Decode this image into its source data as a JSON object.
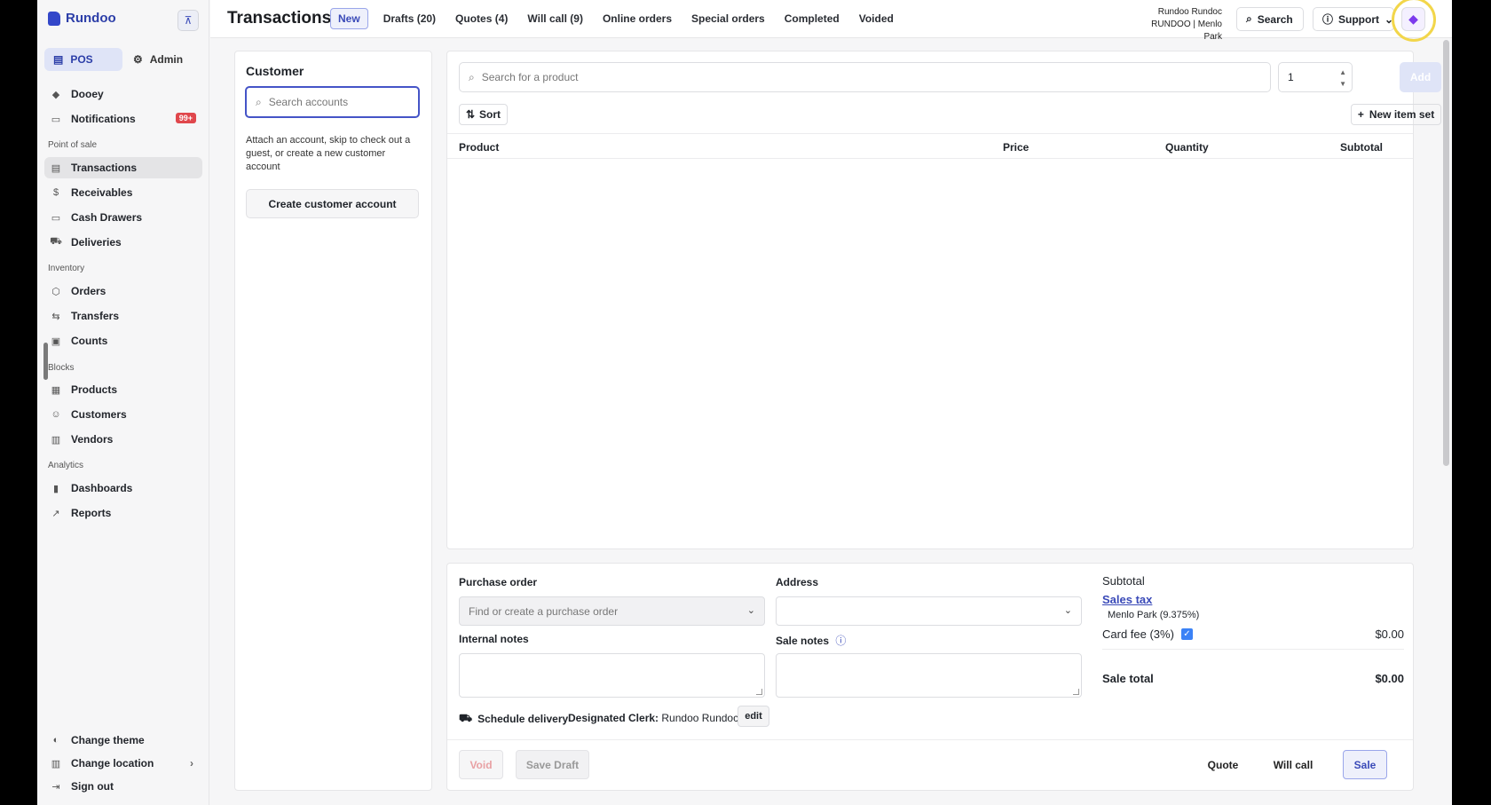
{
  "brand": "Rundoo",
  "sidebar": {
    "modes": [
      {
        "label": "POS"
      },
      {
        "label": "Admin"
      }
    ],
    "top_items": [
      {
        "label": "Dooey",
        "icon": "dooey-icon"
      },
      {
        "label": "Notifications",
        "icon": "inbox-icon",
        "badge": "99+"
      }
    ],
    "sections": [
      {
        "title": "Point of sale",
        "items": [
          {
            "label": "Transactions",
            "icon": "receipt-icon",
            "active": true
          },
          {
            "label": "Receivables",
            "icon": "dollar-circle-icon"
          },
          {
            "label": "Cash Drawers",
            "icon": "cash-icon"
          },
          {
            "label": "Deliveries",
            "icon": "truck-icon"
          }
        ]
      },
      {
        "title": "Inventory",
        "items": [
          {
            "label": "Orders",
            "icon": "box-icon"
          },
          {
            "label": "Transfers",
            "icon": "arrows-icon"
          },
          {
            "label": "Counts",
            "icon": "clipboard-icon"
          }
        ]
      },
      {
        "title": "Blocks",
        "items": [
          {
            "label": "Products",
            "icon": "grid-icon"
          },
          {
            "label": "Customers",
            "icon": "users-icon"
          },
          {
            "label": "Vendors",
            "icon": "building-icon"
          }
        ]
      },
      {
        "title": "Analytics",
        "items": [
          {
            "label": "Dashboards",
            "icon": "bar-chart-icon"
          },
          {
            "label": "Reports",
            "icon": "line-chart-icon"
          }
        ]
      }
    ],
    "bottom_items": [
      {
        "label": "Change theme",
        "icon": "palette-icon"
      },
      {
        "label": "Change location",
        "icon": "building-icon"
      },
      {
        "label": "Sign out",
        "icon": "sign-out-icon"
      }
    ]
  },
  "header": {
    "title": "Transactions",
    "tabs": [
      {
        "label": "New",
        "active": true
      },
      {
        "label": "Drafts (20)"
      },
      {
        "label": "Quotes (4)"
      },
      {
        "label": "Will call (9)"
      },
      {
        "label": "Online orders"
      },
      {
        "label": "Special orders"
      },
      {
        "label": "Completed"
      },
      {
        "label": "Voided"
      }
    ],
    "user_name": "Rundoo Rundoc",
    "user_location": "RUNDOO | Menlo Park",
    "search_label": "Search",
    "support_label": "Support"
  },
  "customer": {
    "title": "Customer",
    "search_placeholder": "Search accounts",
    "help": "Attach an account, skip to check out a guest, or create a new customer account",
    "create_label": "Create customer account"
  },
  "products": {
    "search_placeholder": "Search for a product",
    "quantity": "1",
    "add_label": "Add",
    "sort_label": "Sort",
    "new_set_label": "New item set",
    "columns": [
      "Product",
      "Price",
      "Quantity",
      "Subtotal"
    ]
  },
  "order": {
    "po_label": "Purchase order",
    "po_placeholder": "Find or create a purchase order",
    "address_label": "Address",
    "address_value": "",
    "internal_notes_label": "Internal notes",
    "sale_notes_label": "Sale notes",
    "schedule_delivery": "Schedule delivery",
    "clerk_label": "Designated Clerk:",
    "clerk_name": "Rundoo Rundoc",
    "edit_label": "edit"
  },
  "totals": {
    "subtotal_label": "Subtotal",
    "sales_tax_label": "Sales tax",
    "tax_location": "Menlo Park (9.375%)",
    "card_fee_label": "Card fee (3%)",
    "card_fee_checked": true,
    "card_fee_value": "$0.00",
    "sale_total_label": "Sale total",
    "sale_total_value": "$0.00"
  },
  "actions": {
    "void": "Void",
    "save_draft": "Save Draft",
    "quote": "Quote",
    "will_call": "Will call",
    "sale": "Sale"
  },
  "colors": {
    "accent": "#3a4ab8",
    "highlight": "#f2d64a",
    "badge": "#e0474c"
  }
}
